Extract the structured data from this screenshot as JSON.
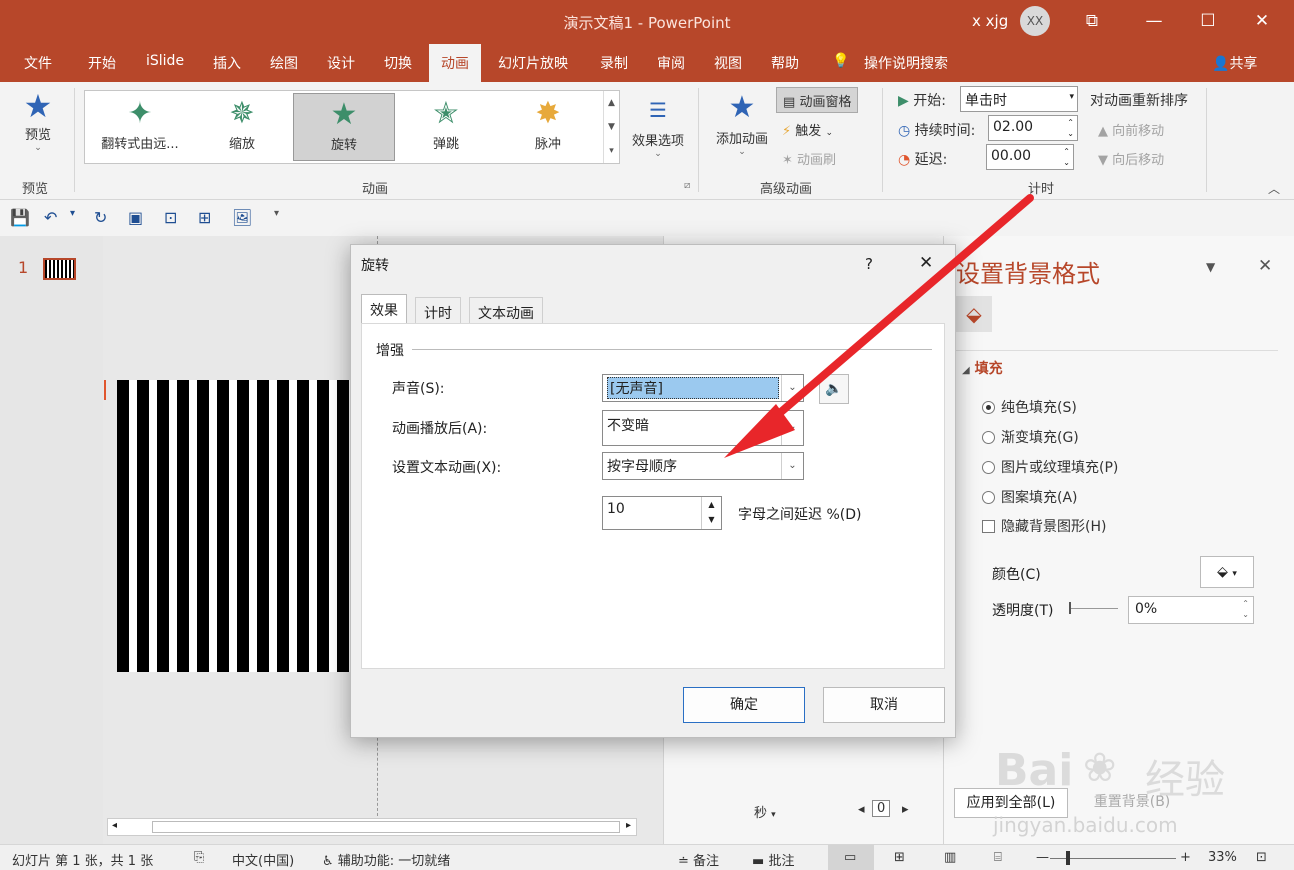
{
  "window": {
    "title": "演示文稿1  -  PowerPoint",
    "user": "x xjg",
    "avatar": "XX"
  },
  "tabs": [
    "文件",
    "开始",
    "iSlide",
    "插入",
    "绘图",
    "设计",
    "切换",
    "动画",
    "幻灯片放映",
    "录制",
    "审阅",
    "视图",
    "帮助"
  ],
  "tabs_extra": {
    "tell_me": "操作说明搜索",
    "share": "共享"
  },
  "ribbon": {
    "preview": {
      "label": "预览",
      "group": "预览"
    },
    "gallery": [
      {
        "label": "翻转式由远..."
      },
      {
        "label": "缩放"
      },
      {
        "label": "旋转"
      },
      {
        "label": "弹跳"
      },
      {
        "label": "脉冲"
      }
    ],
    "effect_options": "效果选项",
    "group_animation": "动画",
    "add_animation": "添加动画",
    "anim_pane": "动画窗格",
    "trigger": "触发",
    "anim_painter": "动画刷",
    "group_advanced": "高级动画",
    "start_label": "开始:",
    "start_value": "单击时",
    "duration_label": "持续时间:",
    "duration_value": "02.00",
    "delay_label": "延迟:",
    "delay_value": "00.00",
    "group_timing": "计时",
    "reorder": "对动画重新排序",
    "move_earlier": "向前移动",
    "move_later": "向后移动"
  },
  "thumb": {
    "number": "1"
  },
  "anim_pane_footer": {
    "seconds": "秒",
    "page": "0"
  },
  "format_pane": {
    "title": "设置背景格式",
    "section": "填充",
    "options": [
      "纯色填充(S)",
      "渐变填充(G)",
      "图片或纹理填充(P)",
      "图案填充(A)"
    ],
    "hide_bg": "隐藏背景图形(H)",
    "color": "颜色(C)",
    "transparency": "透明度(T)",
    "transparency_value": "0%",
    "apply_all": "应用到全部(L)",
    "reset": "重置背景(B)"
  },
  "dialog": {
    "title": "旋转",
    "help": "?",
    "tabs": [
      "效果",
      "计时",
      "文本动画"
    ],
    "section": "增强",
    "sound_label": "声音(S):",
    "sound_value": "[无声音]",
    "after_label": "动画播放后(A):",
    "after_value": "不变暗",
    "text_label": "设置文本动画(X):",
    "text_value": "按字母顺序",
    "delay_value": "10",
    "delay_label": "字母之间延迟 %(D)",
    "ok": "确定",
    "cancel": "取消"
  },
  "status": {
    "slide": "幻灯片 第 1 张，共 1 张",
    "lang": "中文(中国)",
    "access": "辅助功能: 一切就绪",
    "notes": "备注",
    "comments": "批注",
    "zoom": "33%"
  },
  "watermark": {
    "brand": "Bai",
    "brand2": "经验",
    "url": "jingyan.baidu.com"
  },
  "colors": {
    "accent": "#b7472a",
    "arrow": "#e8262a"
  }
}
